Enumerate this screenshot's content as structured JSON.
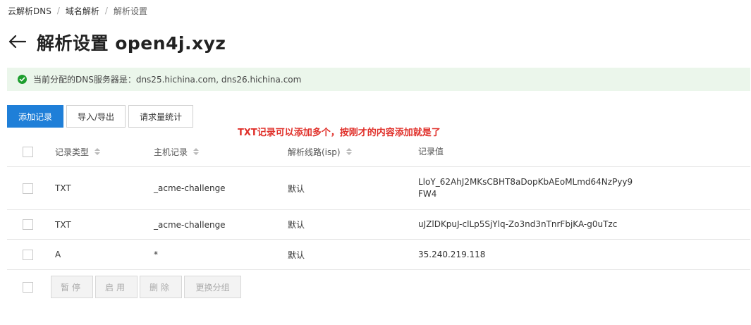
{
  "breadcrumb": {
    "items": [
      "云解析DNS",
      "域名解析",
      "解析设置"
    ],
    "separator": "/"
  },
  "header": {
    "back_icon": "arrow-left-icon",
    "title": "解析设置 open4j.xyz"
  },
  "notice": {
    "icon": "check-circle-icon",
    "text": "当前分配的DNS服务器是：dns25.hichina.com, dns26.hichina.com",
    "color": "#1e9e2f"
  },
  "toolbar": {
    "add_label": "添加记录",
    "import_export_label": "导入/导出",
    "stats_label": "请求量统计",
    "accent": "#1f7fd8"
  },
  "annotation": {
    "text": "TXT记录可以添加多个，按刚才的内容添加就是了",
    "color": "#e0302a"
  },
  "table": {
    "columns": {
      "type": "记录类型",
      "host": "主机记录",
      "line": "解析线路(isp)",
      "value": "记录值"
    },
    "rows": [
      {
        "type": "TXT",
        "host": "_acme-challenge",
        "line": "默认",
        "value_line1": "LloY_62AhJ2MKsCBHT8aDopKbAEoMLmd64NzPyy9",
        "value_line2": "FW4"
      },
      {
        "type": "TXT",
        "host": "_acme-challenge",
        "line": "默认",
        "value_line1": "uJZlDKpuJ-clLp5SjYlq-Zo3nd3nTnrFbjKA-g0uTzc",
        "value_line2": ""
      },
      {
        "type": "A",
        "host": "*",
        "line": "默认",
        "value_line1": "35.240.219.118",
        "value_line2": ""
      }
    ]
  },
  "footer": {
    "pause_label": "暂停",
    "enable_label": "启用",
    "delete_label": "删除",
    "change_group_label": "更换分组"
  }
}
